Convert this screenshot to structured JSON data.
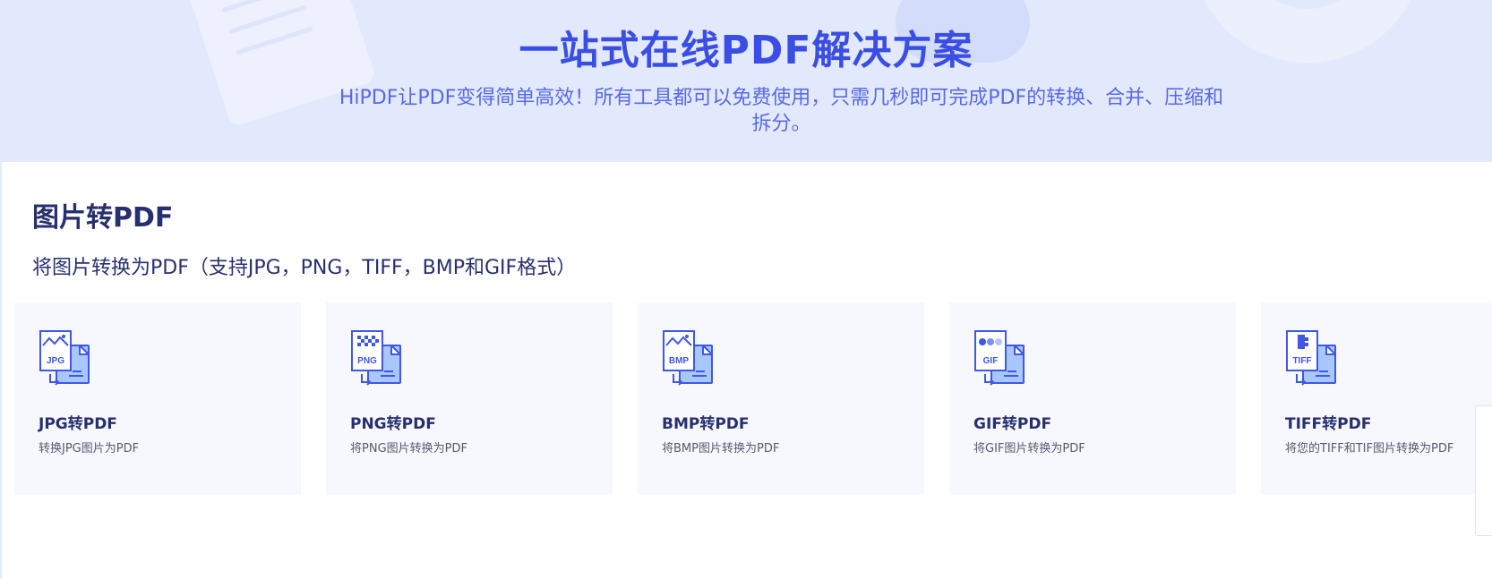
{
  "hero": {
    "title": "一站式在线PDF解决方案",
    "subtitle": "HiPDF让PDF变得简单高效！所有工具都可以免费使用，只需几秒即可完成PDF的转换、合并、压缩和拆分。"
  },
  "section": {
    "title": "图片转PDF",
    "description": "将图片转换为PDF（支持JPG，PNG，TIFF，BMP和GIF格式）"
  },
  "cards": [
    {
      "title": "JPG转PDF",
      "description": "转换JPG图片为PDF",
      "badge": "JPG",
      "icon": "jpg-to-pdf-icon"
    },
    {
      "title": "PNG转PDF",
      "description": "将PNG图片转换为PDF",
      "badge": "PNG",
      "icon": "png-to-pdf-icon"
    },
    {
      "title": "BMP转PDF",
      "description": "将BMP图片转换为PDF",
      "badge": "BMP",
      "icon": "bmp-to-pdf-icon"
    },
    {
      "title": "GIF转PDF",
      "description": "将GIF图片转换为PDF",
      "badge": "GIF",
      "icon": "gif-to-pdf-icon"
    },
    {
      "title": "TIFF转PDF",
      "description": "将您的TIFF和TIF图片转换为PDF",
      "badge": "TIFF",
      "icon": "tiff-to-pdf-icon"
    }
  ],
  "colors": {
    "hero_background": "#e3e9fd",
    "brand_blue": "#3a4ee6",
    "heading_navy": "#27306e",
    "card_background": "#f6f8fe",
    "icon_fill": "#a9c7ff"
  }
}
